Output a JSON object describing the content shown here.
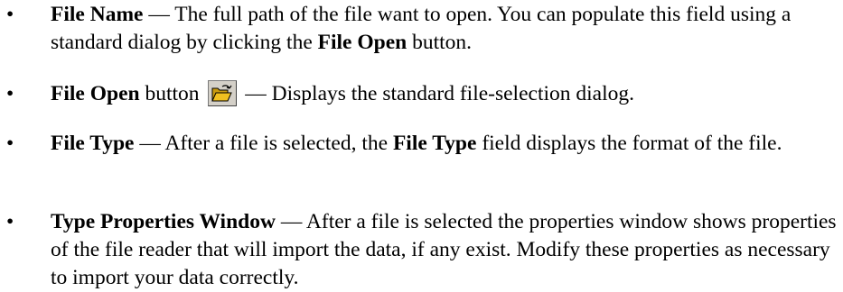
{
  "bullet_glyph": "•",
  "items": [
    {
      "term": "File Name",
      "text1": " — The full path of the file want to open. You can populate this field using a standard dialog by clicking the ",
      "ref": "File Open",
      "text2": " button."
    },
    {
      "term": "File Open",
      "text1": " button ",
      "text2": " — Displays the standard file-selection dialog.",
      "icon": "folder-open-icon"
    },
    {
      "term": "File Type",
      "text1": " — After a file is selected, the ",
      "ref": "File Type",
      "text2": " field displays the format of the file."
    },
    {
      "term": "Type Properties Window",
      "text1": " — After a file is selected the properties window shows properties of the file reader that will import the data, if any exist. Modify these properties as necessary to import your data correctly."
    }
  ],
  "colors": {
    "text": "#000000",
    "background": "#ffffff",
    "icon_folder": "#f0c020",
    "icon_button_face": "#d4d0c8"
  }
}
